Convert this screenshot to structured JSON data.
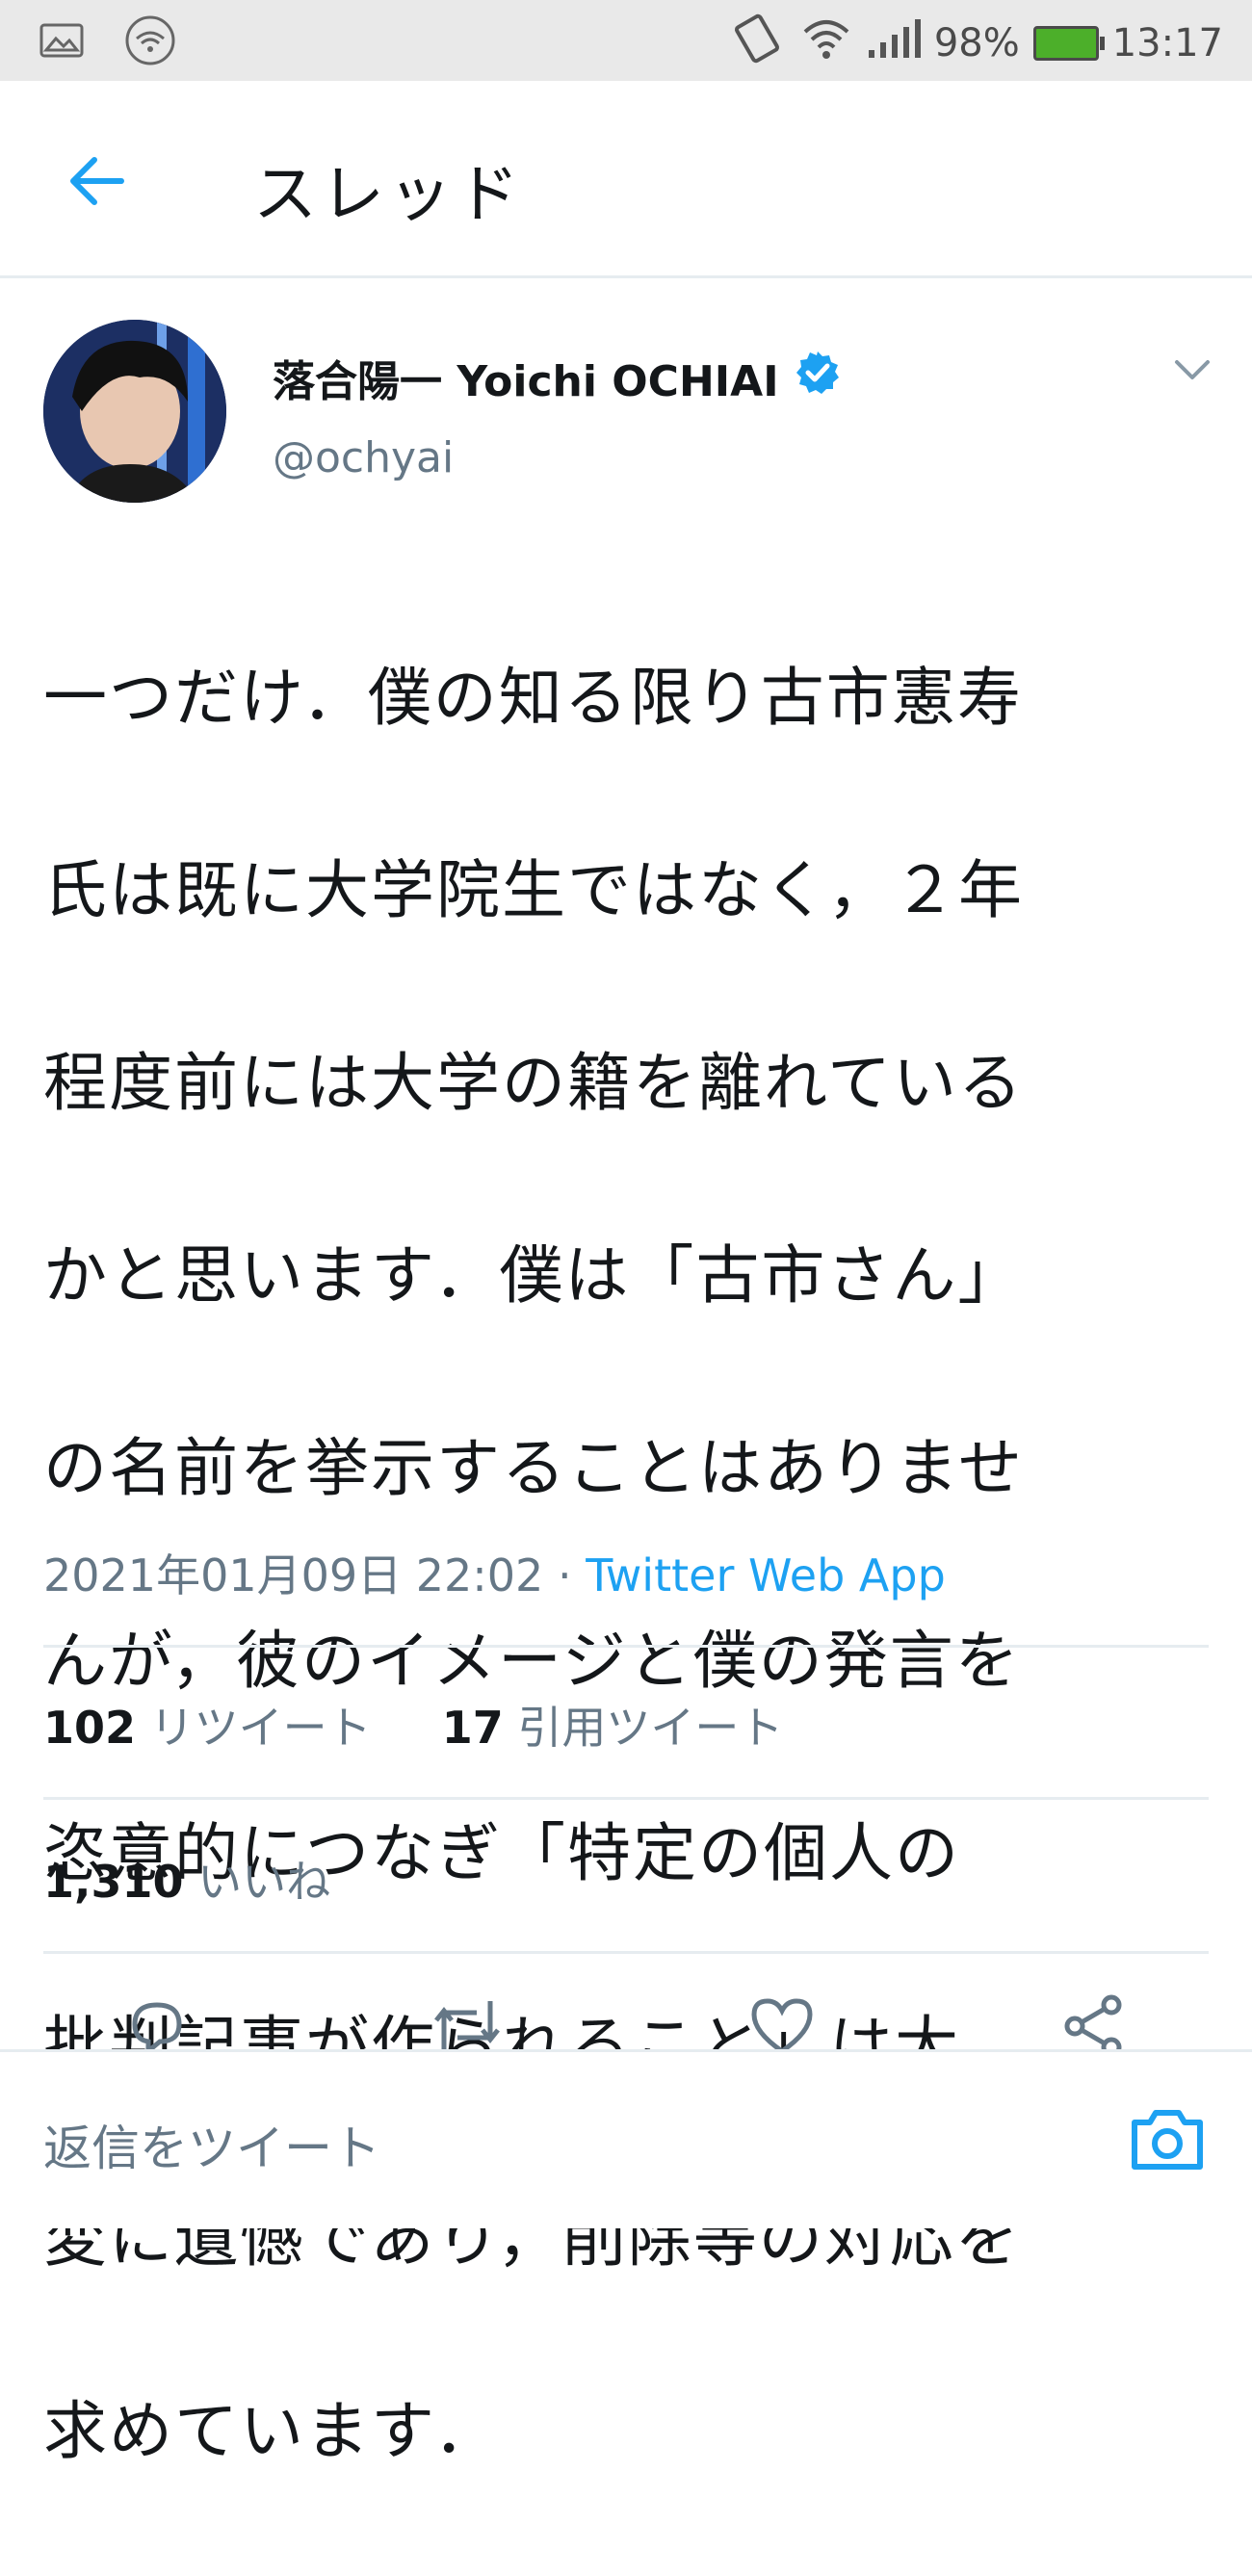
{
  "status_bar": {
    "battery_percent": "98%",
    "time": "13:17"
  },
  "header": {
    "title": "スレッド"
  },
  "tweet": {
    "author_name": "落合陽一 Yoichi OCHIAI",
    "handle": "@ochyai",
    "text_lines": [
      "一つだけ．僕の知る限り古市憲寿",
      "氏は既に大学院生ではなく，２年",
      "程度前には大学の籍を離れている",
      "かと思います．僕は「古市さん」",
      "の名前を挙示することはありませ",
      "んが，彼のイメージと僕の発言を",
      "恣意的につなぎ「特定の個人の",
      "批判記事が作られること」は大",
      "変に遺憾であり，削除等の対応を",
      "求めています．"
    ],
    "timestamp": "2021年01月09日 22:02",
    "separator": " · ",
    "source": "Twitter Web App"
  },
  "stats": {
    "retweets_count": "102",
    "retweets_label": "リツイート",
    "quotes_count": "17",
    "quotes_label": "引用ツイート",
    "likes_count": "1,310",
    "likes_label": "いいね"
  },
  "reply_bar": {
    "placeholder": "返信をツイート"
  },
  "colors": {
    "accent": "#1da1f2",
    "secondary_text": "#657786",
    "divider": "#e6ecf0",
    "battery_fill": "#4caf2a"
  },
  "icons": {
    "back": "arrow-left-icon",
    "verified": "verified-badge-icon",
    "more": "chevron-down-icon",
    "reply": "reply-icon",
    "retweet": "retweet-icon",
    "like": "heart-icon",
    "share": "share-icon",
    "camera": "camera-icon"
  }
}
